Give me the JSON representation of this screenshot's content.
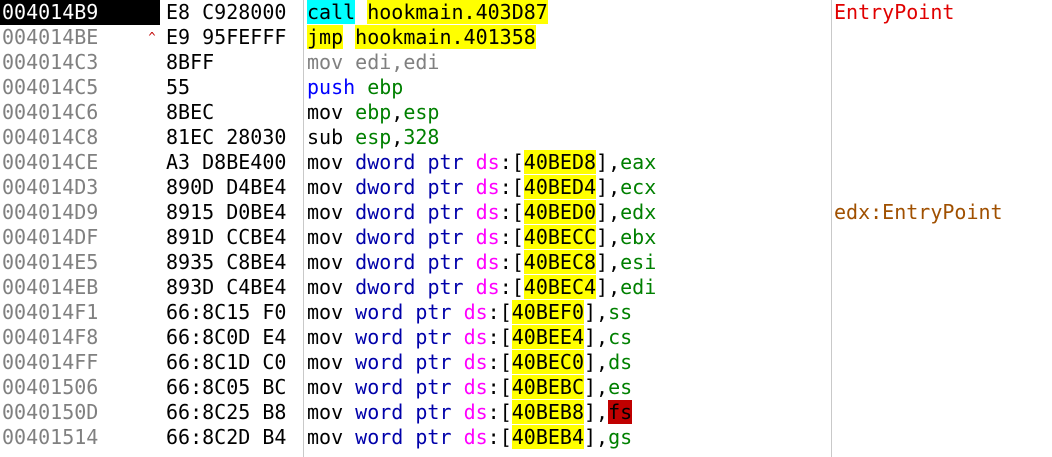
{
  "rows": [
    {
      "addr": "004014B9",
      "mark": "",
      "bytes": "E8 C928000",
      "selected": true,
      "tokens": [
        [
          "call",
          "t-call"
        ],
        [
          " ",
          "t-plain"
        ],
        [
          "hookmain.403D87",
          "t-target"
        ]
      ],
      "comment": "EntryPoint",
      "comment_class": "cm-entry"
    },
    {
      "addr": "004014BE",
      "mark": "^",
      "bytes": "E9 95FEFFF",
      "selected": false,
      "tokens": [
        [
          "jmp",
          "t-jmp"
        ],
        [
          " ",
          "t-plain"
        ],
        [
          "hookmain.401358",
          "t-target"
        ]
      ],
      "comment": "",
      "comment_class": ""
    },
    {
      "addr": "004014C3",
      "mark": "",
      "bytes": "8BFF",
      "selected": false,
      "tokens": [
        [
          "mov edi,edi",
          "t-nop"
        ]
      ],
      "comment": "",
      "comment_class": ""
    },
    {
      "addr": "004014C5",
      "mark": "",
      "bytes": "55",
      "selected": false,
      "tokens": [
        [
          "push",
          "t-stack"
        ],
        [
          " ",
          "t-plain"
        ],
        [
          "ebp",
          "t-reg"
        ]
      ],
      "comment": "",
      "comment_class": ""
    },
    {
      "addr": "004014C6",
      "mark": "",
      "bytes": "8BEC",
      "selected": false,
      "tokens": [
        [
          "mov",
          "t-plain"
        ],
        [
          " ",
          "t-plain"
        ],
        [
          "ebp",
          "t-reg"
        ],
        [
          ",",
          "t-comma"
        ],
        [
          "esp",
          "t-reg"
        ]
      ],
      "comment": "",
      "comment_class": ""
    },
    {
      "addr": "004014C8",
      "mark": "",
      "bytes": "81EC 28030",
      "selected": false,
      "tokens": [
        [
          "sub",
          "t-plain"
        ],
        [
          " ",
          "t-plain"
        ],
        [
          "esp",
          "t-reg"
        ],
        [
          ",",
          "t-comma"
        ],
        [
          "328",
          "t-imm"
        ]
      ],
      "comment": "",
      "comment_class": ""
    },
    {
      "addr": "004014CE",
      "mark": "",
      "bytes": "A3 D8BE400",
      "selected": false,
      "tokens": [
        [
          "mov",
          "t-plain"
        ],
        [
          " ",
          "t-plain"
        ],
        [
          "dword",
          "t-size"
        ],
        [
          " ",
          "t-plain"
        ],
        [
          "ptr",
          "t-ptr"
        ],
        [
          " ",
          "t-plain"
        ],
        [
          "ds",
          "t-seg"
        ],
        [
          ":",
          "t-colon"
        ],
        [
          "[",
          "t-brk"
        ],
        [
          "40BED8",
          "t-mem"
        ],
        [
          "]",
          "t-brk"
        ],
        [
          ",",
          "t-comma"
        ],
        [
          "eax",
          "t-reg"
        ]
      ],
      "comment": "",
      "comment_class": ""
    },
    {
      "addr": "004014D3",
      "mark": "",
      "bytes": "890D D4BE4",
      "selected": false,
      "tokens": [
        [
          "mov",
          "t-plain"
        ],
        [
          " ",
          "t-plain"
        ],
        [
          "dword",
          "t-size"
        ],
        [
          " ",
          "t-plain"
        ],
        [
          "ptr",
          "t-ptr"
        ],
        [
          " ",
          "t-plain"
        ],
        [
          "ds",
          "t-seg"
        ],
        [
          ":",
          "t-colon"
        ],
        [
          "[",
          "t-brk"
        ],
        [
          "40BED4",
          "t-mem"
        ],
        [
          "]",
          "t-brk"
        ],
        [
          ",",
          "t-comma"
        ],
        [
          "ecx",
          "t-reg"
        ]
      ],
      "comment": "",
      "comment_class": ""
    },
    {
      "addr": "004014D9",
      "mark": "",
      "bytes": "8915 D0BE4",
      "selected": false,
      "tokens": [
        [
          "mov",
          "t-plain"
        ],
        [
          " ",
          "t-plain"
        ],
        [
          "dword",
          "t-size"
        ],
        [
          " ",
          "t-plain"
        ],
        [
          "ptr",
          "t-ptr"
        ],
        [
          " ",
          "t-plain"
        ],
        [
          "ds",
          "t-seg"
        ],
        [
          ":",
          "t-colon"
        ],
        [
          "[",
          "t-brk"
        ],
        [
          "40BED0",
          "t-mem"
        ],
        [
          "]",
          "t-brk"
        ],
        [
          ",",
          "t-comma"
        ],
        [
          "edx",
          "t-reg"
        ]
      ],
      "comment": "edx:EntryPoint",
      "comment_class": "cm-label"
    },
    {
      "addr": "004014DF",
      "mark": "",
      "bytes": "891D CCBE4",
      "selected": false,
      "tokens": [
        [
          "mov",
          "t-plain"
        ],
        [
          " ",
          "t-plain"
        ],
        [
          "dword",
          "t-size"
        ],
        [
          " ",
          "t-plain"
        ],
        [
          "ptr",
          "t-ptr"
        ],
        [
          " ",
          "t-plain"
        ],
        [
          "ds",
          "t-seg"
        ],
        [
          ":",
          "t-colon"
        ],
        [
          "[",
          "t-brk"
        ],
        [
          "40BECC",
          "t-mem"
        ],
        [
          "]",
          "t-brk"
        ],
        [
          ",",
          "t-comma"
        ],
        [
          "ebx",
          "t-reg"
        ]
      ],
      "comment": "",
      "comment_class": ""
    },
    {
      "addr": "004014E5",
      "mark": "",
      "bytes": "8935 C8BE4",
      "selected": false,
      "tokens": [
        [
          "mov",
          "t-plain"
        ],
        [
          " ",
          "t-plain"
        ],
        [
          "dword",
          "t-size"
        ],
        [
          " ",
          "t-plain"
        ],
        [
          "ptr",
          "t-ptr"
        ],
        [
          " ",
          "t-plain"
        ],
        [
          "ds",
          "t-seg"
        ],
        [
          ":",
          "t-colon"
        ],
        [
          "[",
          "t-brk"
        ],
        [
          "40BEC8",
          "t-mem"
        ],
        [
          "]",
          "t-brk"
        ],
        [
          ",",
          "t-comma"
        ],
        [
          "esi",
          "t-reg"
        ]
      ],
      "comment": "",
      "comment_class": ""
    },
    {
      "addr": "004014EB",
      "mark": "",
      "bytes": "893D C4BE4",
      "selected": false,
      "tokens": [
        [
          "mov",
          "t-plain"
        ],
        [
          " ",
          "t-plain"
        ],
        [
          "dword",
          "t-size"
        ],
        [
          " ",
          "t-plain"
        ],
        [
          "ptr",
          "t-ptr"
        ],
        [
          " ",
          "t-plain"
        ],
        [
          "ds",
          "t-seg"
        ],
        [
          ":",
          "t-colon"
        ],
        [
          "[",
          "t-brk"
        ],
        [
          "40BEC4",
          "t-mem"
        ],
        [
          "]",
          "t-brk"
        ],
        [
          ",",
          "t-comma"
        ],
        [
          "edi",
          "t-reg"
        ]
      ],
      "comment": "",
      "comment_class": ""
    },
    {
      "addr": "004014F1",
      "mark": "",
      "bytes": "66:8C15 F0",
      "selected": false,
      "tokens": [
        [
          "mov",
          "t-plain"
        ],
        [
          " ",
          "t-plain"
        ],
        [
          "word",
          "t-size"
        ],
        [
          " ",
          "t-plain"
        ],
        [
          "ptr",
          "t-ptr"
        ],
        [
          " ",
          "t-plain"
        ],
        [
          "ds",
          "t-seg"
        ],
        [
          ":",
          "t-colon"
        ],
        [
          "[",
          "t-brk"
        ],
        [
          "40BEF0",
          "t-mem"
        ],
        [
          "]",
          "t-brk"
        ],
        [
          ",",
          "t-comma"
        ],
        [
          "ss",
          "t-reg"
        ]
      ],
      "comment": "",
      "comment_class": ""
    },
    {
      "addr": "004014F8",
      "mark": "",
      "bytes": "66:8C0D E4",
      "selected": false,
      "tokens": [
        [
          "mov",
          "t-plain"
        ],
        [
          " ",
          "t-plain"
        ],
        [
          "word",
          "t-size"
        ],
        [
          " ",
          "t-plain"
        ],
        [
          "ptr",
          "t-ptr"
        ],
        [
          " ",
          "t-plain"
        ],
        [
          "ds",
          "t-seg"
        ],
        [
          ":",
          "t-colon"
        ],
        [
          "[",
          "t-brk"
        ],
        [
          "40BEE4",
          "t-mem"
        ],
        [
          "]",
          "t-brk"
        ],
        [
          ",",
          "t-comma"
        ],
        [
          "cs",
          "t-reg"
        ]
      ],
      "comment": "",
      "comment_class": ""
    },
    {
      "addr": "004014FF",
      "mark": "",
      "bytes": "66:8C1D C0",
      "selected": false,
      "tokens": [
        [
          "mov",
          "t-plain"
        ],
        [
          " ",
          "t-plain"
        ],
        [
          "word",
          "t-size"
        ],
        [
          " ",
          "t-plain"
        ],
        [
          "ptr",
          "t-ptr"
        ],
        [
          " ",
          "t-plain"
        ],
        [
          "ds",
          "t-seg"
        ],
        [
          ":",
          "t-colon"
        ],
        [
          "[",
          "t-brk"
        ],
        [
          "40BEC0",
          "t-mem"
        ],
        [
          "]",
          "t-brk"
        ],
        [
          ",",
          "t-comma"
        ],
        [
          "ds",
          "t-reg"
        ]
      ],
      "comment": "",
      "comment_class": ""
    },
    {
      "addr": "00401506",
      "mark": "",
      "bytes": "66:8C05 BC",
      "selected": false,
      "tokens": [
        [
          "mov",
          "t-plain"
        ],
        [
          " ",
          "t-plain"
        ],
        [
          "word",
          "t-size"
        ],
        [
          " ",
          "t-plain"
        ],
        [
          "ptr",
          "t-ptr"
        ],
        [
          " ",
          "t-plain"
        ],
        [
          "ds",
          "t-seg"
        ],
        [
          ":",
          "t-colon"
        ],
        [
          "[",
          "t-brk"
        ],
        [
          "40BEBC",
          "t-mem"
        ],
        [
          "]",
          "t-brk"
        ],
        [
          ",",
          "t-comma"
        ],
        [
          "es",
          "t-reg"
        ]
      ],
      "comment": "",
      "comment_class": ""
    },
    {
      "addr": "0040150D",
      "mark": "",
      "bytes": "66:8C25 B8",
      "selected": false,
      "tokens": [
        [
          "mov",
          "t-plain"
        ],
        [
          " ",
          "t-plain"
        ],
        [
          "word",
          "t-size"
        ],
        [
          " ",
          "t-plain"
        ],
        [
          "ptr",
          "t-ptr"
        ],
        [
          " ",
          "t-plain"
        ],
        [
          "ds",
          "t-seg"
        ],
        [
          ":",
          "t-colon"
        ],
        [
          "[",
          "t-brk"
        ],
        [
          "40BEB8",
          "t-mem"
        ],
        [
          "]",
          "t-brk"
        ],
        [
          ",",
          "t-comma"
        ],
        [
          "fs",
          "t-regfs"
        ]
      ],
      "comment": "",
      "comment_class": ""
    },
    {
      "addr": "00401514",
      "mark": "",
      "bytes": "66:8C2D B4",
      "selected": false,
      "tokens": [
        [
          "mov",
          "t-plain"
        ],
        [
          " ",
          "t-plain"
        ],
        [
          "word",
          "t-size"
        ],
        [
          " ",
          "t-plain"
        ],
        [
          "ptr",
          "t-ptr"
        ],
        [
          " ",
          "t-plain"
        ],
        [
          "ds",
          "t-seg"
        ],
        [
          ":",
          "t-colon"
        ],
        [
          "[",
          "t-brk"
        ],
        [
          "40BEB4",
          "t-mem"
        ],
        [
          "]",
          "t-brk"
        ],
        [
          ",",
          "t-comma"
        ],
        [
          "gs",
          "t-reg"
        ]
      ],
      "comment": "",
      "comment_class": ""
    }
  ]
}
